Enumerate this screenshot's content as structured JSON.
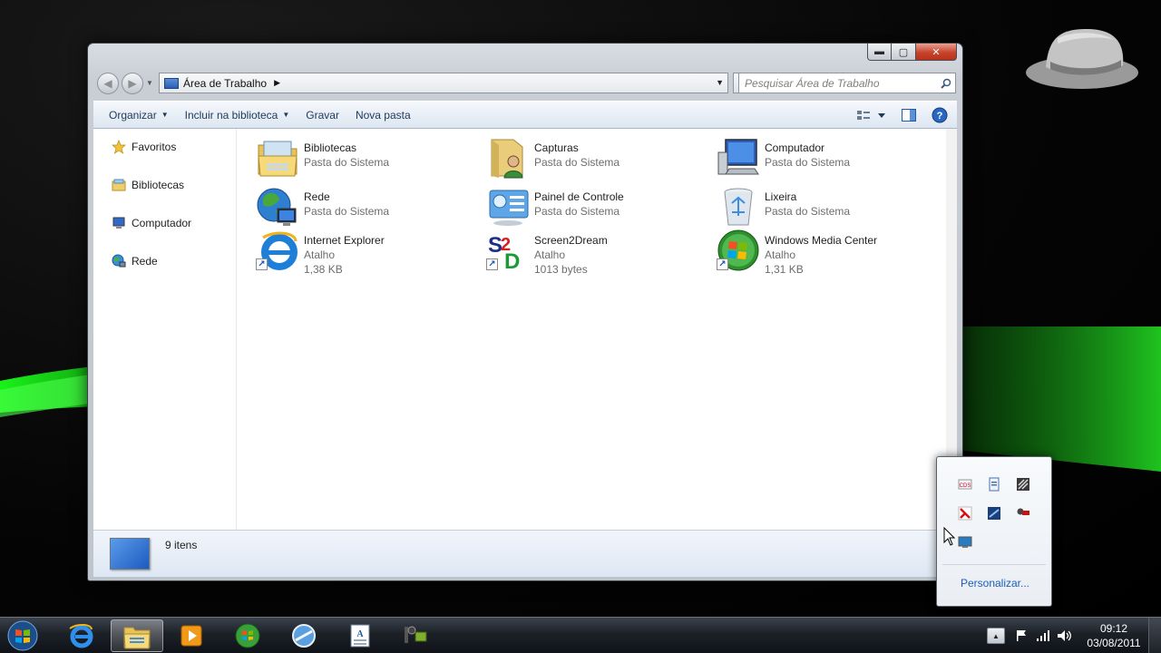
{
  "window": {
    "address_path": "Área de Trabalho",
    "search_placeholder": "Pesquisar Área de Trabalho",
    "controls": {
      "minimize": "▬",
      "maximize": "▢",
      "close": "✕"
    }
  },
  "toolbar": {
    "organize": "Organizar",
    "include_library": "Incluir na biblioteca",
    "burn": "Gravar",
    "new_folder": "Nova pasta"
  },
  "nav_pane": {
    "items": [
      {
        "label": "Favoritos",
        "icon": "star-icon"
      },
      {
        "label": "Bibliotecas",
        "icon": "libraries-icon"
      },
      {
        "label": "Computador",
        "icon": "computer-icon"
      },
      {
        "label": "Rede",
        "icon": "network-icon"
      }
    ]
  },
  "files": [
    {
      "name": "Bibliotecas",
      "type": "Pasta do Sistema",
      "size": "",
      "icon": "libraries-folder-icon"
    },
    {
      "name": "Capturas",
      "type": "Pasta do Sistema",
      "size": "",
      "icon": "user-folder-icon"
    },
    {
      "name": "Computador",
      "type": "Pasta do Sistema",
      "size": "",
      "icon": "computer-icon"
    },
    {
      "name": "Rede",
      "type": "Pasta do Sistema",
      "size": "",
      "icon": "network-globe-icon"
    },
    {
      "name": "Painel de Controle",
      "type": "Pasta do Sistema",
      "size": "",
      "icon": "control-panel-icon"
    },
    {
      "name": "Lixeira",
      "type": "Pasta do Sistema",
      "size": "",
      "icon": "recycle-bin-icon"
    },
    {
      "name": "Internet Explorer",
      "type": "Atalho",
      "size": "1,38 KB",
      "icon": "internet-explorer-icon"
    },
    {
      "name": "Screen2Dream",
      "type": "Atalho",
      "size": "1013 bytes",
      "icon": "screen2dream-icon"
    },
    {
      "name": "Windows Media Center",
      "type": "Atalho",
      "size": "1,31 KB",
      "icon": "windows-media-center-icon"
    }
  ],
  "details": {
    "count": "9 itens"
  },
  "tray_popup": {
    "customize": "Personalizar..."
  },
  "clock": {
    "time": "09:12",
    "date": "03/08/2011"
  },
  "colors": {
    "accent": "#1e395b",
    "link": "#1a5fb4",
    "selection_green": "#2bd92b"
  }
}
